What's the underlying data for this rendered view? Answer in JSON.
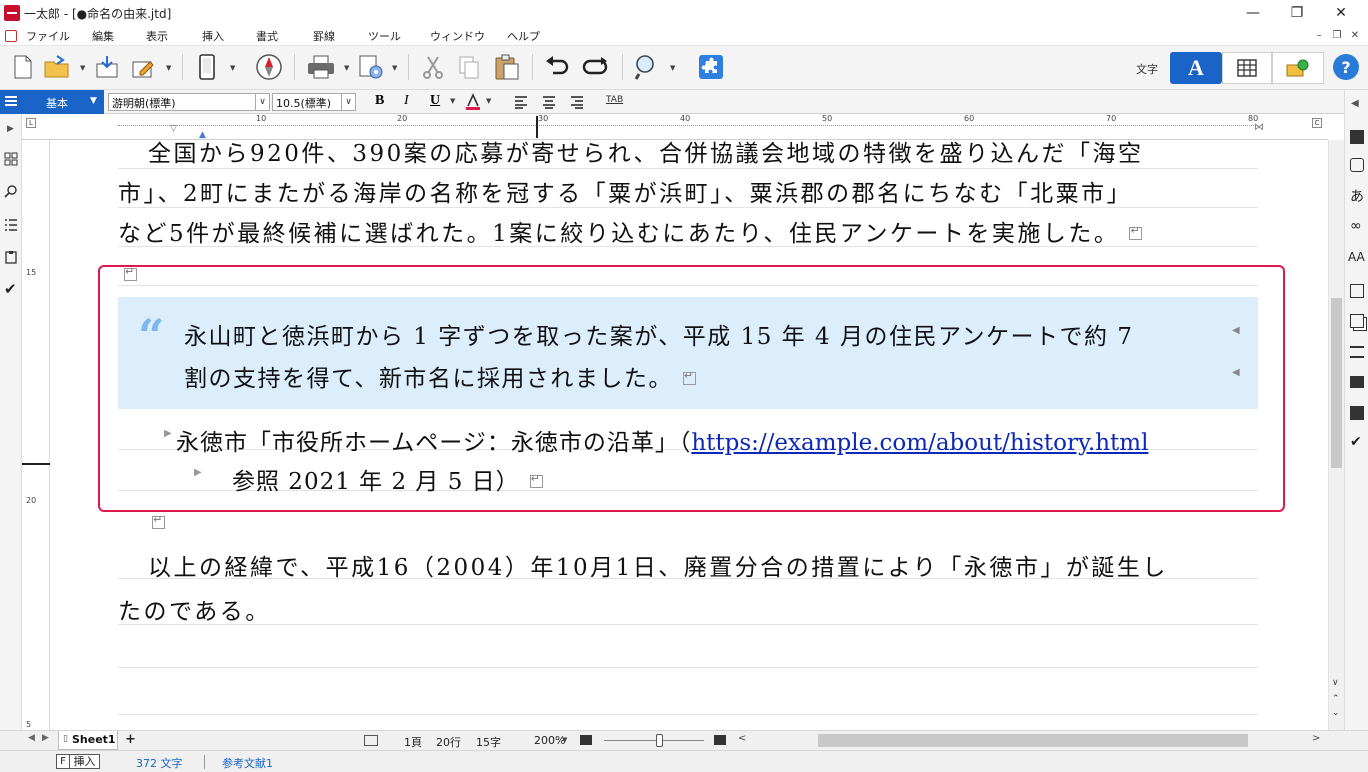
{
  "window": {
    "title": "一太郎 - [●命名の由来.jtd]"
  },
  "menu": {
    "items": [
      "ファイル",
      "編集",
      "表示",
      "挿入",
      "書式",
      "罫線",
      "ツール",
      "ウィンドウ",
      "ヘルプ"
    ]
  },
  "toolbar": {
    "mode_label": "文字"
  },
  "format_bar": {
    "style": "基本",
    "font": "游明朝(標準)",
    "size": "10.5(標準)",
    "bold": "B",
    "italic": "I",
    "underline": "U",
    "tab": "TAB"
  },
  "ruler": {
    "ticks": [
      "10",
      "20",
      "30",
      "40",
      "50",
      "60",
      "70",
      "80"
    ],
    "left_marker": "L",
    "right_marker": "C",
    "vertical_ticks": [
      "15",
      "20",
      "5"
    ]
  },
  "document": {
    "para1_line1": "全国から920件、390案の応募が寄せられ、合併協議会地域の特徴を盛り込んだ「海空",
    "para1_line2": "市」、2町にまたがる海岸の名称を冠する「粟が浜町」、粟浜郡の郡名にちなむ「北粟市」",
    "para1_line3": "など5件が最終候補に選ばれた。1案に絞り込むにあたり、住民アンケートを実施した。",
    "quote_mark": "“",
    "quote_line1": "永山町と徳浜町から 1 字ずつを取った案が、平成 15 年 4 月の住民アンケートで約 7",
    "quote_line2": "割の支持を得て、新市名に採用されました。",
    "cite_line1_prefix": "永徳市「市役所ホームページ：永徳市の沿革」（",
    "cite_link": "https://example.com/about/history.html",
    "cite_line2": "参照  2021 年 2 月 5 日）",
    "para2_line1": "以上の経緯で、平成16（2004）年10月1日、廃置分合の措置により「永徳市」が誕生し",
    "para2_line2": "たのである。"
  },
  "bottom_bar": {
    "sheet_tab": "Sheet1",
    "page": "1頁",
    "row": "20行",
    "col": "15字",
    "zoom": "200%"
  },
  "status": {
    "key": "F",
    "mode": "挿入",
    "chars": "372 文字",
    "context": "参考文献1"
  },
  "colors": {
    "accent_blue": "#1a63c7",
    "quote_bg": "#dcedfb",
    "frame_red": "#e0194d",
    "link_blue": "#0b28b8"
  }
}
